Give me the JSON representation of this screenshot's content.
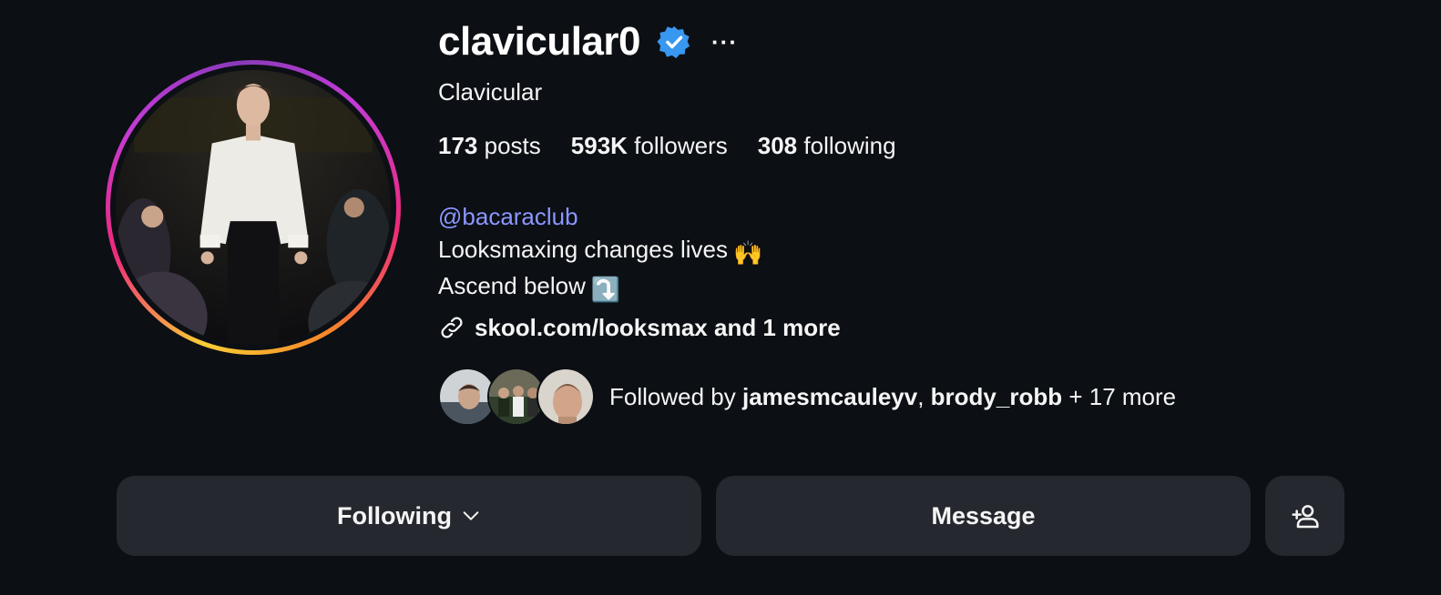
{
  "profile": {
    "username": "clavicular0",
    "full_name": "Clavicular",
    "verified": true,
    "more_label": "···"
  },
  "stats": {
    "posts_count": "173",
    "posts_label": "posts",
    "followers_count": "593K",
    "followers_label": "followers",
    "following_count": "308",
    "following_label": "following"
  },
  "bio": {
    "mention": "@bacaraclub",
    "line1": "Looksmaxing changes lives",
    "line1_emoji": "🙌",
    "line2": "Ascend below",
    "line2_emoji": "⤵️",
    "link": "skool.com/looksmax and 1 more"
  },
  "followed_by": {
    "prefix": "Followed by ",
    "user1": "jamesmcauleyv",
    "separator": ", ",
    "user2": "brody_robb",
    "suffix": " + 17 more"
  },
  "actions": {
    "following_label": "Following",
    "message_label": "Message"
  },
  "icons": {
    "verified": "verified-badge-icon",
    "link": "link-icon",
    "chevron": "chevron-down-icon",
    "add_user": "add-user-icon"
  },
  "colors": {
    "background": "#0c0f14",
    "button": "#25282e",
    "mention": "#8c96ff",
    "verified": "#3897f0"
  }
}
